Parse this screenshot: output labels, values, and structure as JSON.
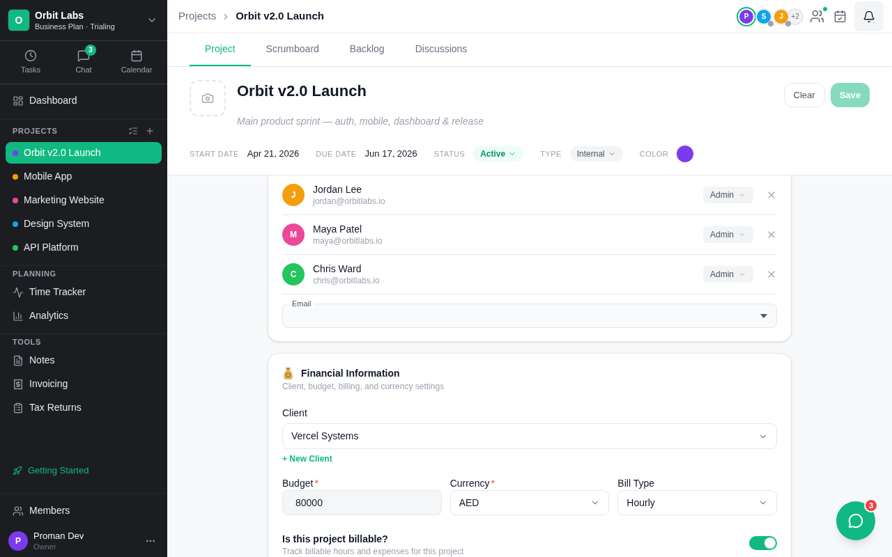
{
  "sidebar": {
    "workspace": {
      "initial": "O",
      "name": "Orbit Labs",
      "plan": "Business Plan · Trialing"
    },
    "quick_nav": [
      {
        "label": "Tasks"
      },
      {
        "label": "Chat",
        "badge": "3"
      },
      {
        "label": "Calendar"
      }
    ],
    "nav": [
      {
        "label": "Dashboard",
        "selected": false
      }
    ],
    "sections": [
      {
        "title": "PROJECTS",
        "kind": "projects",
        "items": [
          {
            "label": "Orbit v2.0 Launch",
            "color": "#7c3aed",
            "selected": true
          },
          {
            "label": "Mobile App",
            "color": "#f59e0b",
            "selected": false
          },
          {
            "label": "Marketing Website",
            "color": "#ec4899",
            "selected": false
          },
          {
            "label": "Design System",
            "color": "#0ea5e9",
            "selected": false
          },
          {
            "label": "API Platform",
            "color": "#22c55e",
            "selected": false
          }
        ]
      },
      {
        "title": "PLANNING",
        "kind": "links",
        "items": [
          {
            "label": "Time Tracker",
            "selected": false
          },
          {
            "label": "Analytics",
            "selected": false
          }
        ]
      },
      {
        "title": "TOOLS",
        "kind": "links",
        "items": [
          {
            "label": "Notes",
            "selected": false
          },
          {
            "label": "Invoicing",
            "selected": false
          },
          {
            "label": "Tax Returns",
            "selected": false
          }
        ]
      }
    ],
    "getting_started": "Getting Started",
    "footer_nav": [
      {
        "label": "Members",
        "selected": false
      }
    ],
    "user": {
      "initial": "P",
      "name": "Proman Dev",
      "role": "Owner"
    }
  },
  "topbar": {
    "breadcrumb": [
      "Projects",
      "Orbit v2.0 Launch"
    ],
    "avatars": [
      {
        "initial": "P",
        "color": "#7c3aed",
        "online": true
      },
      {
        "initial": "S",
        "color": "#0ea5e9",
        "online": false
      },
      {
        "initial": "J",
        "color": "#f59e0b",
        "online": false
      }
    ],
    "more_count": "+2",
    "team_unread": true
  },
  "tabs": [
    {
      "label": "Project",
      "selected": true
    },
    {
      "label": "Scrumboard",
      "selected": false
    },
    {
      "label": "Backlog",
      "selected": false
    },
    {
      "label": "Discussions",
      "selected": false
    }
  ],
  "project": {
    "title": "Orbit v2.0 Launch",
    "description": "Main product sprint — auth, mobile, dashboard & release",
    "buttons": [
      {
        "label": "Clear",
        "kind": "secondary",
        "disabled": false
      },
      {
        "label": "Save",
        "kind": "primary",
        "disabled": true
      }
    ],
    "meta": [
      {
        "kind": "date",
        "label": "START DATE",
        "value": "Apr 21, 2026"
      },
      {
        "kind": "date",
        "label": "DUE DATE",
        "value": "Jun 17, 2026"
      },
      {
        "kind": "status",
        "label": "STATUS",
        "value": "Active"
      },
      {
        "kind": "type",
        "label": "TYPE",
        "value": "Internal"
      },
      {
        "kind": "color",
        "label": "COLOR",
        "color": "#7c3aed"
      }
    ]
  },
  "members": {
    "rows": [
      {
        "initial": "J",
        "name": "Jordan Lee",
        "email": "jordan@orbitlabs.io",
        "role": "Admin",
        "color": "#f59e0b"
      },
      {
        "initial": "M",
        "name": "Maya Patel",
        "email": "maya@orbitlabs.io",
        "role": "Admin",
        "color": "#ec4899"
      },
      {
        "initial": "C",
        "name": "Chris Ward",
        "email": "chris@orbitlabs.io",
        "role": "Admin",
        "color": "#22c55e"
      }
    ],
    "email_field": {
      "label": "Email"
    }
  },
  "financial": {
    "title": "Financial Information",
    "subtitle": "Client, budget, billing, and currency settings",
    "client": {
      "label": "Client",
      "value": "Vercel Systems"
    },
    "new_client": "+ New Client",
    "required_mark": "*",
    "fields": [
      {
        "kind": "input",
        "label": "Budget",
        "required": true,
        "value": "80000"
      },
      {
        "kind": "select",
        "label": "Currency",
        "required": true,
        "value": "AED"
      },
      {
        "kind": "select",
        "label": "Bill Type",
        "required": false,
        "value": "Hourly"
      }
    ],
    "billable": {
      "title": "Is this project billable?",
      "subtitle": "Track billable hours and expenses for this project",
      "on": true
    }
  },
  "chat_button": {
    "badge": "3"
  }
}
